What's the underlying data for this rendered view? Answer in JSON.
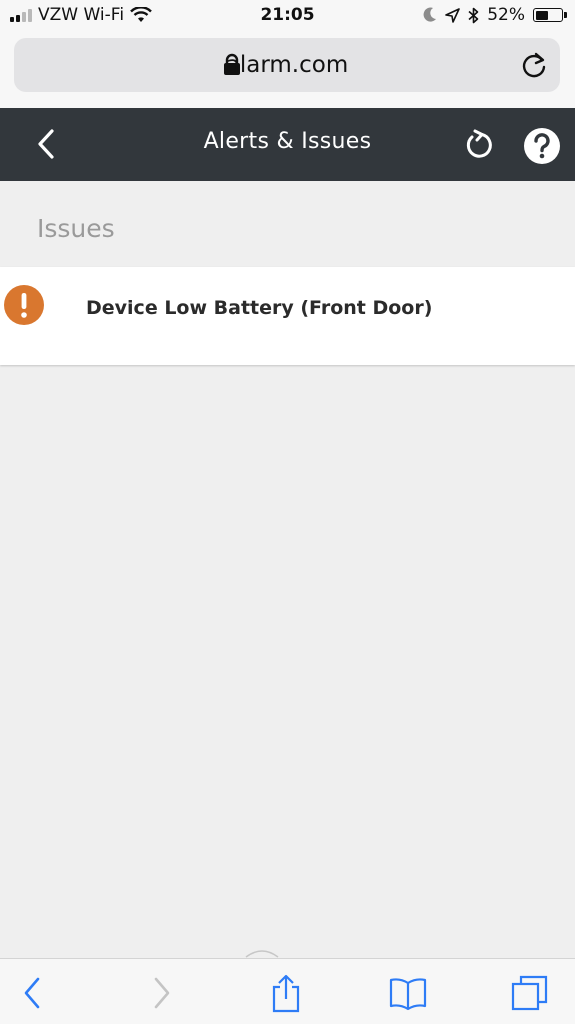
{
  "status_bar": {
    "carrier": "VZW Wi-Fi",
    "time": "21:05",
    "battery_percent": "52%",
    "battery_level": 0.52,
    "icons": [
      "signal-icon",
      "wifi-icon",
      "moon-icon",
      "location-icon",
      "bluetooth-icon",
      "battery-icon"
    ]
  },
  "browser": {
    "url": "alarm.com",
    "icons": [
      "lock-icon",
      "reload-icon"
    ]
  },
  "header": {
    "title": "Alerts & Issues",
    "icons": [
      "back-icon",
      "refresh-icon",
      "help-icon"
    ]
  },
  "issues": {
    "section_title": "Issues",
    "items": [
      {
        "label": "Device Low Battery (Front Door)",
        "icon": "warning-icon",
        "icon_color": "#d9772f"
      }
    ]
  },
  "toolbar": {
    "icons": [
      "back-icon",
      "forward-icon",
      "share-icon",
      "bookmarks-icon",
      "tabs-icon"
    ],
    "accent": "#2e7cf6"
  },
  "colors": {
    "header_bg": "#32373c",
    "page_bg": "#efefef",
    "warning": "#d9772f"
  }
}
